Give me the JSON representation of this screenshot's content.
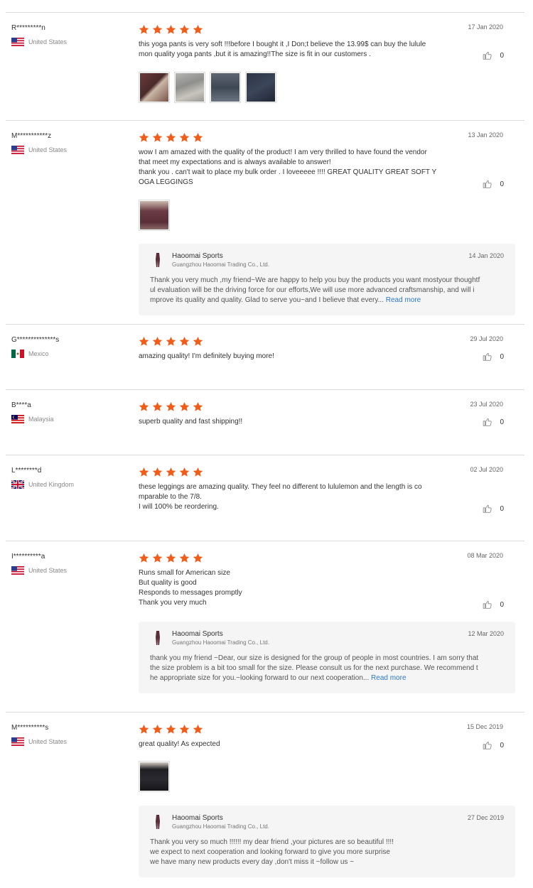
{
  "reviews": [
    {
      "user": "R*********n",
      "country": "United States",
      "date": "17 Jan 2020",
      "body": "this yoga pants is very soft !!!before I bought it ,I Don;t believe the 13.99$ can buy the lulule\nmon quality yoga pants ,but it is amazing!!The size is fit in our customers .",
      "likes": "0",
      "photo_count": 4
    },
    {
      "user": "M***********z",
      "country": "United States",
      "date": "13 Jan 2020",
      "body": "wow I am amazed with the quality of the product! I am very thrilled to have found the vendor\nthat meet my expectations and is always available to answer!\nthank you . can't wait to place my bulk order . I loveeeee !!!! GREAT QUALITY GREAT SOFT Y\nOGA LEGGINGS",
      "likes": "0",
      "photo_count": 1,
      "reply": {
        "seller": "Haoomai Sports",
        "company": "Guangzhou Haoomai Trading Co., Ltd.",
        "date": "14 Jan 2020",
        "text": "Thank you very much ,my friend~We are happy to help you buy the products you want mostyour thoughtf\nul evaluation will be the driving force for our efforts,We will use more advanced craftsmanship, and will i\nmprove its quality and quality. Glad to serve you~and I believe that every...",
        "read_more": "Read more"
      }
    },
    {
      "user": "G**************s",
      "country": "Mexico",
      "date": "29 Jul 2020",
      "body": "amazing quality! I'm definitely buying more!",
      "likes": "0"
    },
    {
      "user": "B****a",
      "country": "Malaysia",
      "date": "23 Jul 2020",
      "body": "superb quality and fast shipping!!",
      "likes": "0"
    },
    {
      "user": "L********d",
      "country": "United Kingdom",
      "date": "02 Jul 2020",
      "body": "these leggings are amazing quality. They feel no different to lululemon and the length is co\nmparable to the 7/8.\nI will 100% be reordering.",
      "likes": "0"
    },
    {
      "user": "I**********a",
      "country": "United States",
      "date": "08 Mar 2020",
      "body": "Runs small for American size\nBut quality is good\nResponds to messages promptly\nThank you very much",
      "likes": "0",
      "reply": {
        "seller": "Haoomai Sports",
        "company": "Guangzhou Haoomai Trading Co., Ltd.",
        "date": "12 Mar 2020",
        "text": "thank you my friend ~Dear, our size is designed for the group of people in most countries. I am sorry that\nthe size problem is a bit too small for the size. Please consult us for the next purchase. We recommend t\nhe appropriate size for you.~looking forward to our next cooperation...",
        "read_more": "Read more"
      }
    },
    {
      "user": "M**********s",
      "country": "United States",
      "date": "15 Dec 2019",
      "body": "great quality! As expected",
      "likes": "0",
      "photo_count": 1,
      "reply": {
        "seller": "Haoomai Sports",
        "company": "Guangzhou Haoomai Trading Co., Ltd.",
        "date": "27 Dec 2019",
        "text": "Thank you very so much !!!!!! my dear friend ,your pictures are so beautiful !!!!\nwe expect to next cooperation and looking forward to give you more surprise\nwe have many new products every day ,don't miss it ~follow us ~",
        "read_more": ""
      }
    }
  ],
  "colors": {
    "star": "#f25c19",
    "link": "#2a78c8"
  }
}
